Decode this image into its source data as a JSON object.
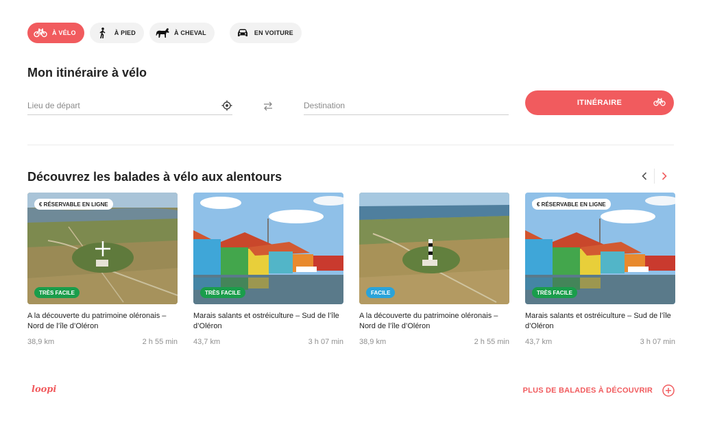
{
  "modes": [
    {
      "label": "À VÉLO",
      "icon": "bike-icon",
      "active": true
    },
    {
      "label": "À PIED",
      "icon": "walk-icon",
      "active": false
    },
    {
      "label": "À CHEVAL",
      "icon": "horse-icon",
      "active": false
    },
    {
      "label": "EN VOITURE",
      "icon": "car-icon",
      "active": false
    }
  ],
  "itinerary": {
    "title": "Mon itinéraire à vélo",
    "start_placeholder": "Lieu de départ",
    "destination_placeholder": "Destination",
    "submit_label": "ITINÉRAIRE"
  },
  "section": {
    "title": "Découvrez les balades à vélo aux alentours"
  },
  "cards": [
    {
      "badge": "€ RÉSERVABLE EN LIGNE",
      "difficulty": "TRÈS FACILE",
      "difficulty_color": "#1a9d4b",
      "title": "A la découverte du patrimoine oléronais – Nord de l’île d’Oléron",
      "distance": "38,9 km",
      "duration": "2 h 55 min",
      "scene": "aerial-lighthouse"
    },
    {
      "badge": "",
      "difficulty": "TRÈS FACILE",
      "difficulty_color": "#1a9d4b",
      "title": "Marais salants et ostréiculture – Sud de l’île d’Oléron",
      "distance": "43,7 km",
      "duration": "3 h 07 min",
      "scene": "colorful-huts"
    },
    {
      "badge": "",
      "difficulty": "FACILE",
      "difficulty_color": "#2aa3d9",
      "title": "A la découverte du patrimoine oléronais – Nord de l’île d’Oléron",
      "distance": "38,9 km",
      "duration": "2 h 55 min",
      "scene": "aerial-lighthouse"
    },
    {
      "badge": "€ RÉSERVABLE EN LIGNE",
      "difficulty": "TRÈS FACILE",
      "difficulty_color": "#1a9d4b",
      "title": "Marais salants et ostréiculture – Sud de l’île d’Oléron",
      "distance": "43,7 km",
      "duration": "3 h 07 min",
      "scene": "colorful-huts"
    }
  ],
  "footer": {
    "logo": "loopi",
    "more_label": "PLUS DE BALADES À DÉCOUVRIR"
  },
  "colors": {
    "accent": "#f15b5e",
    "very_easy": "#1a9d4b",
    "easy": "#2aa3d9"
  }
}
